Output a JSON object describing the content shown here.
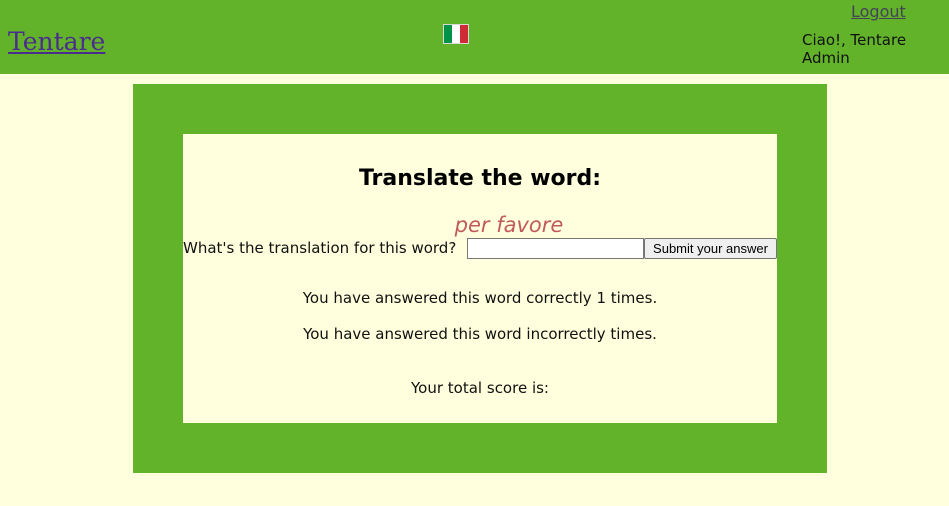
{
  "header": {
    "brand": "Tentare",
    "flag_icon": "italy-flag-icon",
    "flag_colors": [
      "#009246",
      "#ffffff",
      "#ce2b37"
    ],
    "logout_label": "Logout",
    "greeting": "Ciao!, Tentare Admin"
  },
  "quiz": {
    "title": "Translate the word:",
    "word": "per favore",
    "question": "What's the translation for this word?",
    "answer_value": "",
    "submit_label": "Submit your answer",
    "correct_text": "You have answered this word correctly 1 times.",
    "incorrect_text": "You have answered this word incorrectly times.",
    "score_text": "Your total score is:"
  },
  "colors": {
    "accent_green": "#62b22a",
    "background": "#ffffdd",
    "word_color": "#c25a5a",
    "link_purple": "#4a2d8c"
  }
}
